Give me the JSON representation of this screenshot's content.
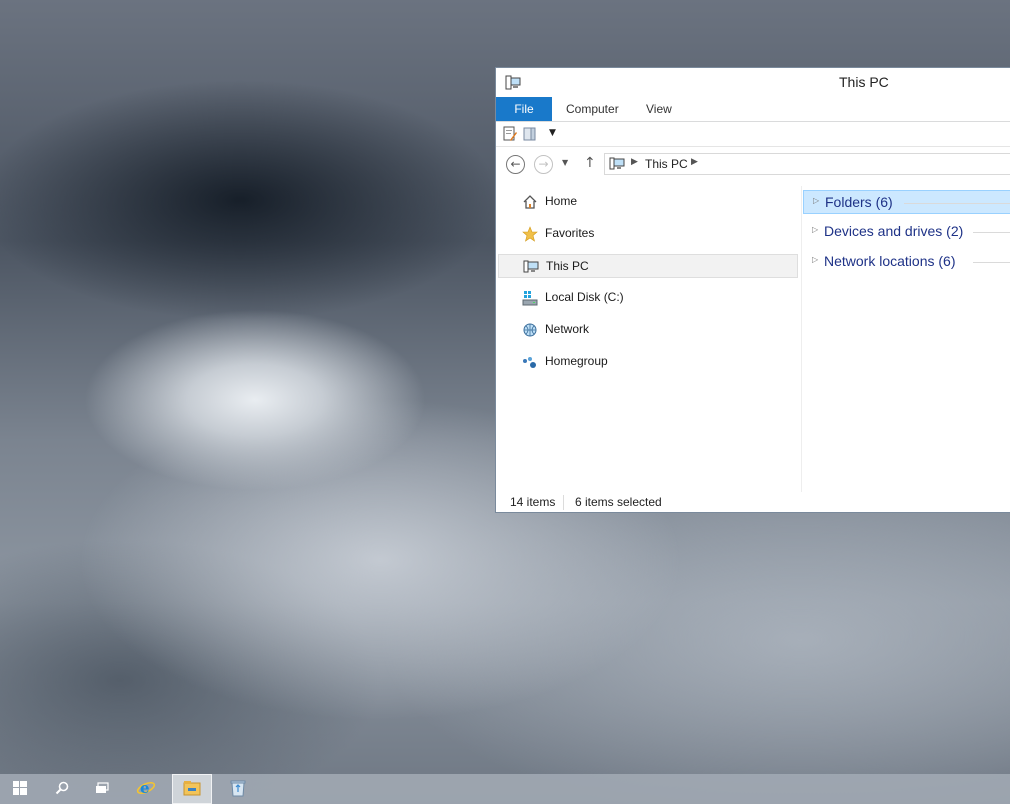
{
  "window": {
    "title": "This PC"
  },
  "ribbon": {
    "file_tab": "File",
    "tabs": [
      "Computer",
      "View"
    ]
  },
  "quick_access": {
    "icons": [
      "properties-icon",
      "new-folder-icon",
      "customize-dropdown-icon"
    ]
  },
  "address": {
    "back": "back-arrow-icon",
    "forward": "forward-arrow-icon",
    "up": "up-arrow-icon",
    "crumbs": [
      "This PC"
    ]
  },
  "nav_pane": {
    "items": [
      {
        "label": "Home",
        "icon": "home-icon",
        "selected": false
      },
      {
        "label": "Favorites",
        "icon": "star-icon",
        "selected": false
      },
      {
        "label": "This PC",
        "icon": "computer-icon",
        "selected": true
      },
      {
        "label": "Local Disk (C:)",
        "icon": "drive-icon",
        "selected": false
      },
      {
        "label": "Network",
        "icon": "network-icon",
        "selected": false
      },
      {
        "label": "Homegroup",
        "icon": "homegroup-icon",
        "selected": false
      }
    ]
  },
  "content": {
    "groups": [
      {
        "label": "Folders (6)",
        "selected": true
      },
      {
        "label": "Devices and drives (2)",
        "selected": false
      },
      {
        "label": "Network locations (6)",
        "selected": false
      }
    ]
  },
  "status": {
    "items": "14 items",
    "selected": "6 items selected"
  },
  "taskbar": {
    "buttons": [
      {
        "icon": "start-windows-icon"
      },
      {
        "icon": "search-icon"
      },
      {
        "icon": "task-view-icon"
      },
      {
        "icon": "internet-explorer-icon"
      },
      {
        "icon": "file-explorer-icon",
        "active": true
      },
      {
        "icon": "recycle-bin-icon"
      }
    ]
  },
  "colors": {
    "accent": "#1979ca",
    "selection": "#cce8ff",
    "group_text": "#1e3287"
  }
}
